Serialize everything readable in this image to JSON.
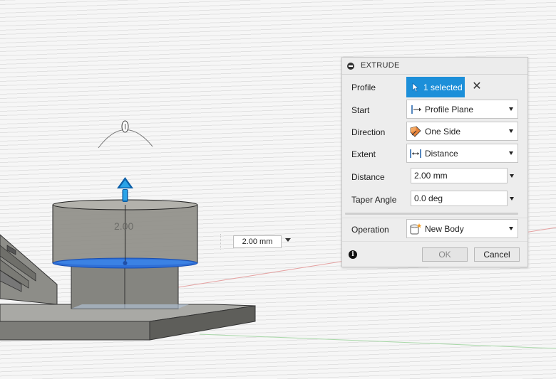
{
  "viewport": {
    "dimension_label": "2.00",
    "distance_input": "2.00 mm"
  },
  "dialog": {
    "title": "EXTRUDE",
    "profile": {
      "label": "Profile",
      "button": "1 selected",
      "clear": "✕"
    },
    "start": {
      "label": "Start",
      "value": "Profile Plane",
      "icon": "profile-plane-icon"
    },
    "direction": {
      "label": "Direction",
      "value": "One Side",
      "icon": "one-side-icon"
    },
    "extent": {
      "label": "Extent",
      "value": "Distance",
      "icon": "distance-icon"
    },
    "distance": {
      "label": "Distance",
      "value": "2.00 mm"
    },
    "taper": {
      "label": "Taper Angle",
      "value": "0.0 deg"
    },
    "operation": {
      "label": "Operation",
      "value": "New Body",
      "icon": "new-body-icon"
    },
    "ok": "OK",
    "cancel": "Cancel",
    "info": "i"
  },
  "colors": {
    "accent": "#1c8fd9",
    "selected_face": "#2f6fd6",
    "body_gray": "#8a8a85"
  }
}
